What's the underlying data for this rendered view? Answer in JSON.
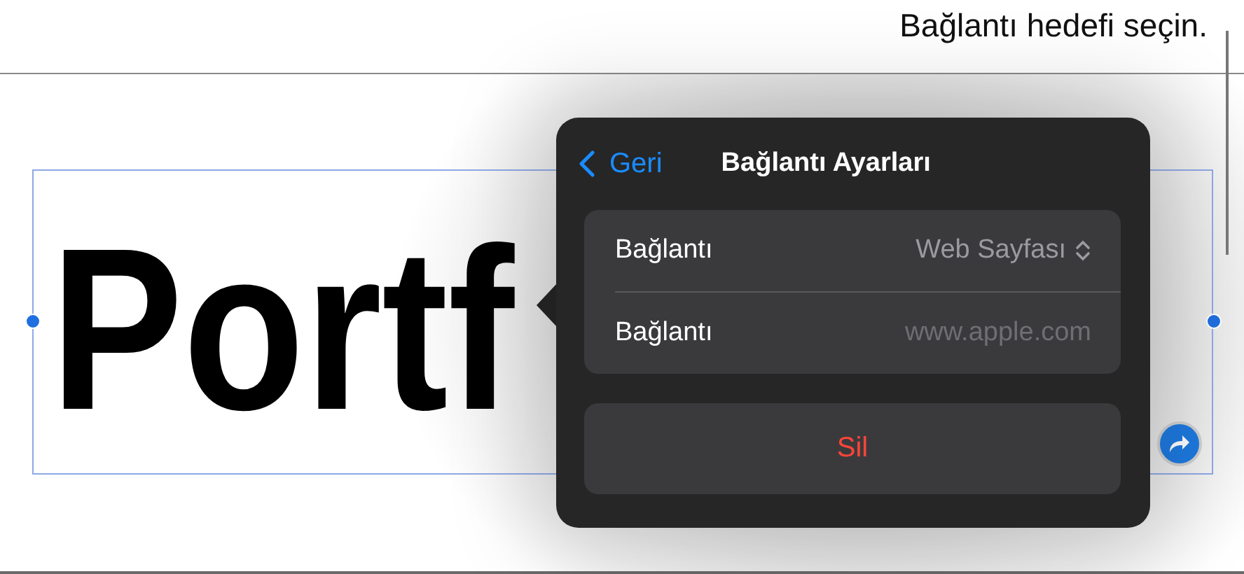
{
  "callout": {
    "text": "Bağlantı hedefi seçin."
  },
  "canvas": {
    "text_fragments": [
      "Portf"
    ]
  },
  "popover": {
    "back": "Geri",
    "title": "Bağlantı Ayarları",
    "rows": [
      {
        "kind": "select",
        "label": "Bağlantı",
        "value": "Web Sayfası"
      },
      {
        "kind": "input",
        "label": "Bağlantı",
        "placeholder": "www.apple.com"
      }
    ],
    "delete": "Sil"
  }
}
